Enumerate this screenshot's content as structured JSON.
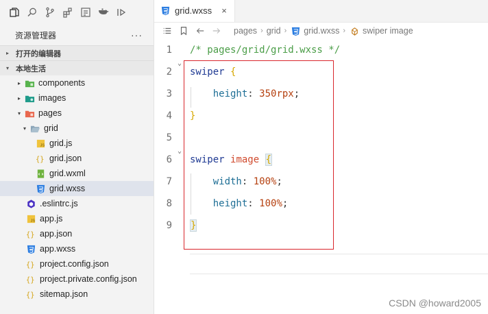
{
  "activity_bar": {
    "icons": [
      "files-icon",
      "search-icon",
      "source-control-icon",
      "extensions-icon",
      "outline-icon",
      "docker-icon",
      "debug-icon"
    ]
  },
  "explorer": {
    "title": "资源管理器",
    "more": "···",
    "sections": {
      "open_editors": "打开的编辑器",
      "workspace": "本地生活"
    },
    "tree": [
      {
        "label": "components",
        "kind": "folder-green",
        "depth": 1,
        "twisty": "▸"
      },
      {
        "label": "images",
        "kind": "folder-teal",
        "depth": 1,
        "twisty": "▸"
      },
      {
        "label": "pages",
        "kind": "folder-red",
        "depth": 1,
        "twisty": "▾"
      },
      {
        "label": "grid",
        "kind": "folder-open",
        "depth": 2,
        "twisty": "▾"
      },
      {
        "label": "grid.js",
        "kind": "js",
        "depth": 3
      },
      {
        "label": "grid.json",
        "kind": "json",
        "depth": 3
      },
      {
        "label": "grid.wxml",
        "kind": "wxml",
        "depth": 3
      },
      {
        "label": "grid.wxss",
        "kind": "wxss",
        "depth": 3,
        "selected": true
      },
      {
        "label": ".eslintrc.js",
        "kind": "eslint",
        "depth": 1
      },
      {
        "label": "app.js",
        "kind": "js",
        "depth": 1
      },
      {
        "label": "app.json",
        "kind": "json",
        "depth": 1
      },
      {
        "label": "app.wxss",
        "kind": "wxss",
        "depth": 1
      },
      {
        "label": "project.config.json",
        "kind": "json",
        "depth": 1
      },
      {
        "label": "project.private.config.json",
        "kind": "json",
        "depth": 1
      },
      {
        "label": "sitemap.json",
        "kind": "json",
        "depth": 1
      }
    ]
  },
  "editor": {
    "tab": {
      "label": "grid.wxss",
      "close": "×"
    },
    "breadcrumb": [
      "pages",
      "grid",
      "grid.wxss",
      "swiper image"
    ],
    "lines": [
      {
        "n": "1",
        "parts": [
          {
            "t": "/* pages/grid/grid.wxss */",
            "c": "comment"
          }
        ]
      },
      {
        "n": "2",
        "parts": [
          {
            "t": "swiper",
            "c": "sel"
          },
          {
            "t": " ",
            "c": "punct"
          },
          {
            "t": "{",
            "c": "brace"
          }
        ]
      },
      {
        "n": "3",
        "parts": [
          {
            "t": "    ",
            "c": "punct"
          },
          {
            "t": "height",
            "c": "prop"
          },
          {
            "t": ": ",
            "c": "punct"
          },
          {
            "t": "350rpx",
            "c": "num"
          },
          {
            "t": ";",
            "c": "punct"
          }
        ]
      },
      {
        "n": "4",
        "parts": [
          {
            "t": "}",
            "c": "brace"
          }
        ]
      },
      {
        "n": "5",
        "parts": []
      },
      {
        "n": "6",
        "parts": [
          {
            "t": "swiper",
            "c": "sel"
          },
          {
            "t": " ",
            "c": "punct"
          },
          {
            "t": "image",
            "c": "tag"
          },
          {
            "t": " ",
            "c": "punct"
          },
          {
            "t": "{",
            "c": "brace"
          }
        ]
      },
      {
        "n": "7",
        "parts": [
          {
            "t": "    ",
            "c": "punct"
          },
          {
            "t": "width",
            "c": "prop"
          },
          {
            "t": ": ",
            "c": "punct"
          },
          {
            "t": "100%",
            "c": "num"
          },
          {
            "t": ";",
            "c": "punct"
          }
        ]
      },
      {
        "n": "8",
        "parts": [
          {
            "t": "    ",
            "c": "punct"
          },
          {
            "t": "height",
            "c": "prop"
          },
          {
            "t": ": ",
            "c": "punct"
          },
          {
            "t": "100%",
            "c": "num"
          },
          {
            "t": ";",
            "c": "punct"
          }
        ]
      },
      {
        "n": "9",
        "parts": [
          {
            "t": "}",
            "c": "brace"
          }
        ]
      }
    ]
  },
  "watermark": "CSDN @howard2005",
  "colors": {
    "annotation_box": "#d9252b",
    "selected_row": "#dfe3ec"
  }
}
